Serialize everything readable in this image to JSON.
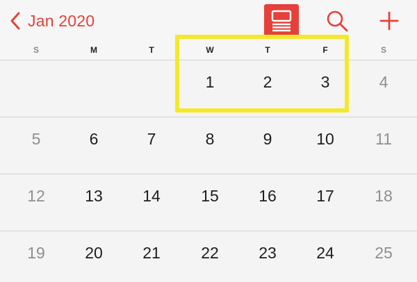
{
  "header": {
    "back_label": "Jan 2020",
    "accent": "#e5413a",
    "icons": [
      "chevron-left-icon",
      "list-view-icon",
      "search-icon",
      "plus-icon"
    ]
  },
  "weekdays": [
    "S",
    "M",
    "T",
    "W",
    "T",
    "F",
    "S"
  ],
  "weeks": [
    [
      "",
      "",
      "",
      "1",
      "2",
      "3",
      "4"
    ],
    [
      "5",
      "6",
      "7",
      "8",
      "9",
      "10",
      "11"
    ],
    [
      "12",
      "13",
      "14",
      "15",
      "16",
      "17",
      "18"
    ],
    [
      "19",
      "20",
      "21",
      "22",
      "23",
      "24",
      "25"
    ]
  ],
  "highlight_color": "#f5e82b"
}
